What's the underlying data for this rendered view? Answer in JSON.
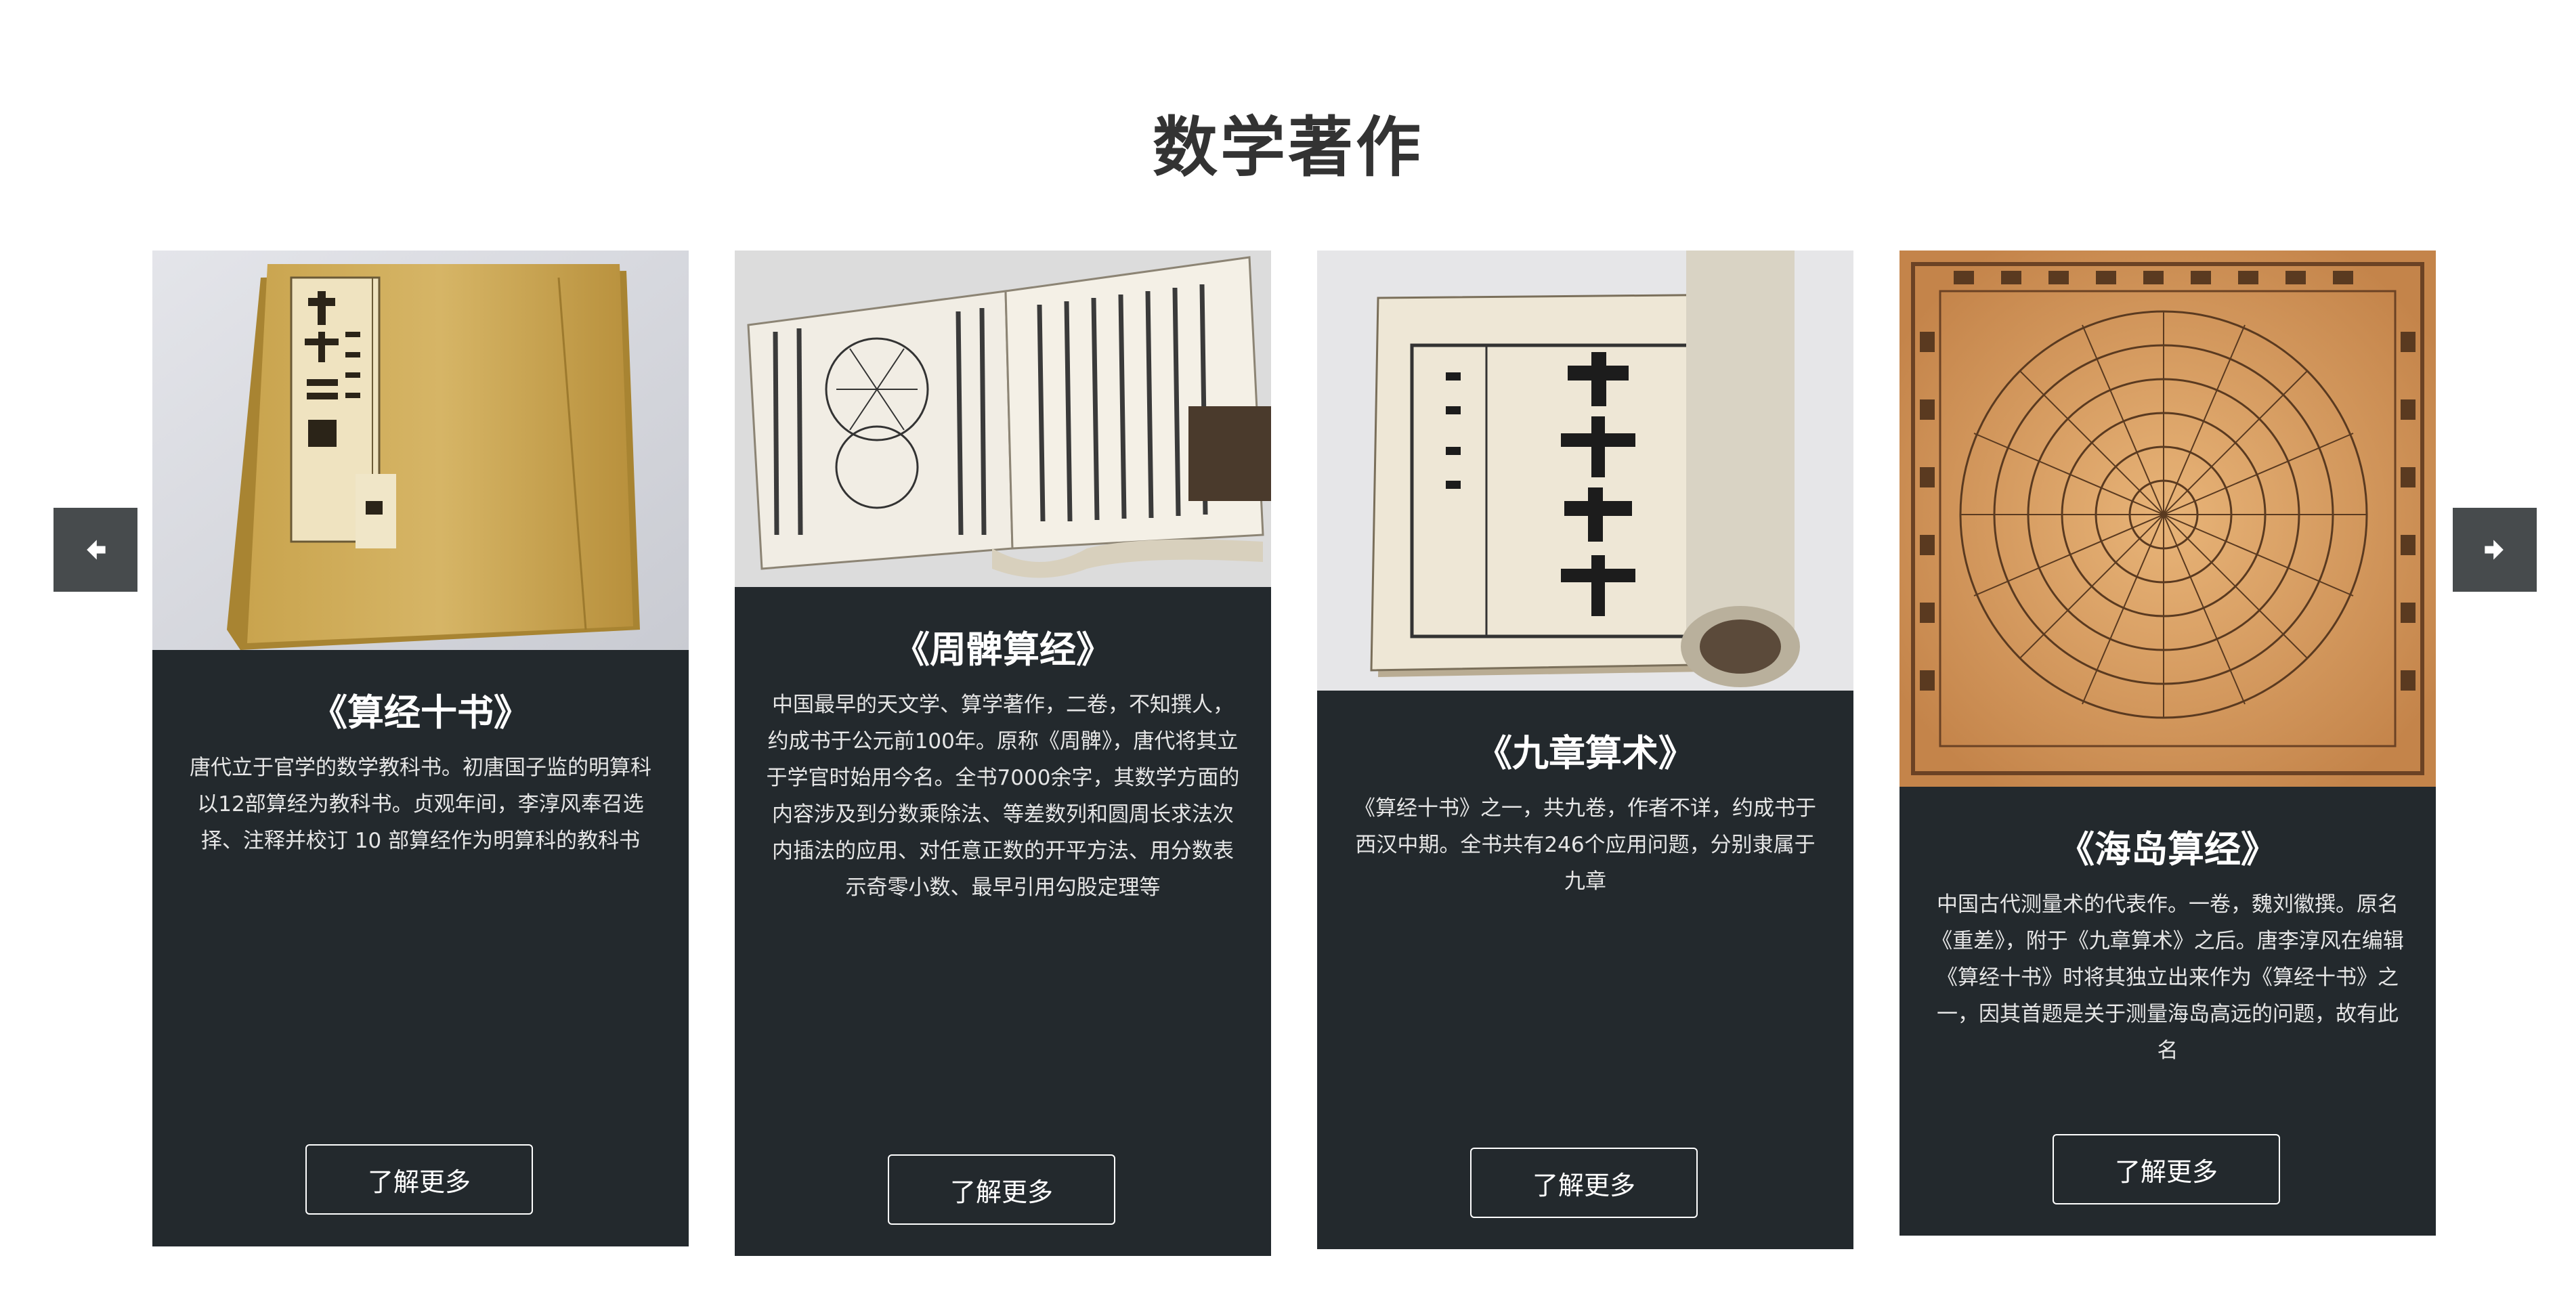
{
  "section": {
    "title": "数学著作"
  },
  "nav": {
    "prev_icon": "arrow-left-icon",
    "next_icon": "arrow-right-icon",
    "button_color": "#474b4d"
  },
  "cards": [
    {
      "title": "《算经十书》",
      "description": "唐代立于官学的数学教科书。初唐国子监的明算科以12部算经为教科书。贞观年间，李淳风奉召选择、注释并校订 10 部算经作为明算科的教科书",
      "button": "了解更多"
    },
    {
      "title": "《周髀算经》",
      "description": "中国最早的天文学、算学著作，二卷，不知撰人，约成书于公元前100年。原称《周髀》，唐代将其立于学官时始用今名。全书7000余字，其数学方面的内容涉及到分数乘除法、等差数列和圆周长求法次内插法的应用、对任意正数的开平方法、用分数表示奇零小数、最早引用勾股定理等",
      "button": "了解更多"
    },
    {
      "title": "《九章算术》",
      "description": "《算经十书》之一，共九卷，作者不详，约成书于西汉中期。全书共有246个应用问题，分别隶属于九章",
      "button": "了解更多"
    },
    {
      "title": "《海岛算经》",
      "description": "中国古代测量术的代表作。一卷，魏刘徽撰。原名《重差》，附于《九章算术》之后。唐李淳风在编辑《算经十书》时将其独立出来作为《算经十书》之一，因其首题是关于测量海岛高远的问题，故有此名",
      "button": "了解更多"
    }
  ],
  "colors": {
    "card_bg": "#23292d",
    "title": "#333333"
  }
}
